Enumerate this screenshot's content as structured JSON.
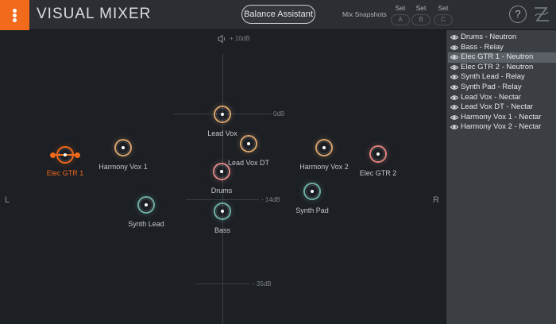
{
  "header": {
    "title": "VISUAL MIXER",
    "balance_button": "Balance Assistant",
    "snapshots_label": "Mix Snapshots",
    "snapshots": [
      {
        "set": "Set",
        "slot": "A"
      },
      {
        "set": "Set",
        "slot": "B"
      },
      {
        "set": "Set",
        "slot": "C"
      }
    ],
    "help": "?"
  },
  "mixer": {
    "top_label": "+ 10dB",
    "db_labels": [
      "0dB",
      "- 14dB",
      "- 35dB"
    ],
    "left": "L",
    "right": "R",
    "nodes": [
      {
        "name": "Elec GTR 1",
        "color": "#f26a1b",
        "selected": true
      },
      {
        "name": "Harmony Vox 1",
        "color": "#d9a36a"
      },
      {
        "name": "Lead Vox",
        "color": "#d9a36a"
      },
      {
        "name": "Lead Vox DT",
        "color": "#d9a36a"
      },
      {
        "name": "Harmony Vox 2",
        "color": "#d9a36a"
      },
      {
        "name": "Elec GTR 2",
        "color": "#e0837a"
      },
      {
        "name": "Drums",
        "color": "#e08a8a"
      },
      {
        "name": "Synth Lead",
        "color": "#6fb0a6"
      },
      {
        "name": "Synth Pad",
        "color": "#6fb0a6"
      },
      {
        "name": "Bass",
        "color": "#6fb0a6"
      }
    ]
  },
  "tracks": [
    {
      "name": "Drums - Neutron",
      "selected": false
    },
    {
      "name": "Bass - Relay",
      "selected": false
    },
    {
      "name": "Elec GTR 1 - Neutron",
      "selected": true
    },
    {
      "name": "Elec GTR 2 - Neutron",
      "selected": false
    },
    {
      "name": "Synth Lead - Relay",
      "selected": false
    },
    {
      "name": "Synth Pad - Relay",
      "selected": false
    },
    {
      "name": "Lead Vox - Nectar",
      "selected": false
    },
    {
      "name": "Lead Vox DT - Nectar",
      "selected": false
    },
    {
      "name": "Harmony Vox 1 - Nectar",
      "selected": false
    },
    {
      "name": "Harmony Vox 2 - Nectar",
      "selected": false
    }
  ]
}
